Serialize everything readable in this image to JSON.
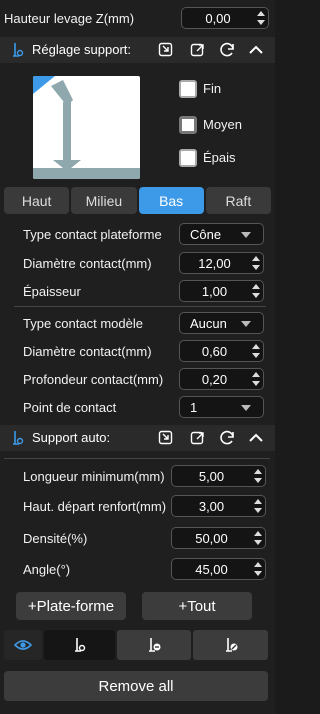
{
  "lift": {
    "label": "Hauteur levage Z(mm)",
    "value": "0,00"
  },
  "support_settings": {
    "title": "Réglage support:",
    "options": [
      "Fin",
      "Moyen",
      "Épais"
    ],
    "selected": "Moyen",
    "tabs": [
      "Haut",
      "Milieu",
      "Bas",
      "Raft"
    ],
    "active_tab": "Bas",
    "platform": {
      "contact_type_label": "Type contact plateforme",
      "contact_type_value": "Cône",
      "diameter_label": "Diamètre contact(mm)",
      "diameter_value": "12,00",
      "thickness_label": "Épaisseur",
      "thickness_value": "1,00"
    },
    "model": {
      "contact_type_label": "Type contact modèle",
      "contact_type_value": "Aucun",
      "diameter_label": "Diamètre contact(mm)",
      "diameter_value": "0,60",
      "depth_label": "Profondeur contact(mm)",
      "depth_value": "0,20",
      "point_label": "Point de contact",
      "point_value": "1"
    }
  },
  "auto_support": {
    "title": "Support auto:",
    "min_length_label": "Longueur minimum(mm)",
    "min_length_value": "5,00",
    "reinforce_label": "Haut. départ renfort(mm)",
    "reinforce_value": "3,00",
    "density_label": "Densité(%)",
    "density_value": "50,00",
    "angle_label": "Angle(°)",
    "angle_value": "45,00"
  },
  "buttons": {
    "platform": "+Plate-forme",
    "all": "+Tout",
    "remove_all": "Remove all"
  },
  "colors": {
    "accent": "#3d9ae8",
    "panel": "#1f1f1f",
    "header": "#2a2a2a"
  }
}
